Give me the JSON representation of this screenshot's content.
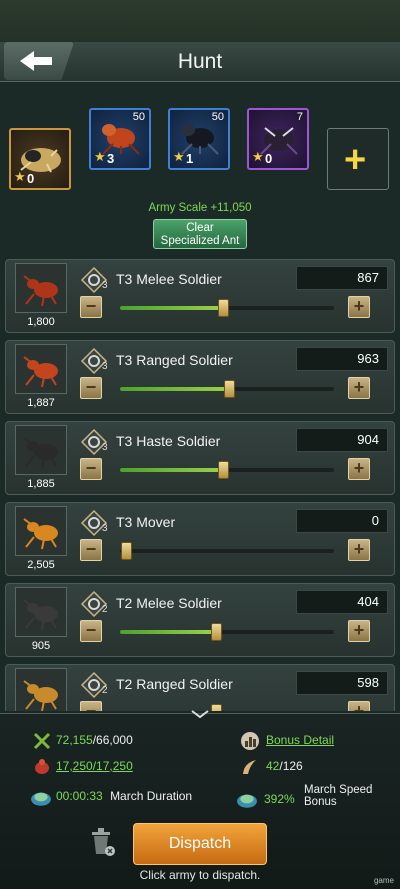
{
  "header": {
    "title": "Hunt"
  },
  "slots": [
    {
      "id": "gold",
      "star_level": "0",
      "count": ""
    },
    {
      "id": "red",
      "star_level": "3",
      "count": "50"
    },
    {
      "id": "black",
      "star_level": "1",
      "count": "50"
    },
    {
      "id": "purple",
      "star_level": "0",
      "count": "7"
    }
  ],
  "army_scale": "Army Scale +11,050",
  "clear_button": {
    "line1": "Clear",
    "line2": "Specialized Ant"
  },
  "troops": [
    {
      "name": "T3 Melee Soldier",
      "tier": "3",
      "available": "1,800",
      "value": "867",
      "fraction": 0.48
    },
    {
      "name": "T3 Ranged Soldier",
      "tier": "3",
      "available": "1,887",
      "value": "963",
      "fraction": 0.51
    },
    {
      "name": "T3 Haste Soldier",
      "tier": "3",
      "available": "1,885",
      "value": "904",
      "fraction": 0.48
    },
    {
      "name": "T3 Mover",
      "tier": "3",
      "available": "2,505",
      "value": "0",
      "fraction": 0.0
    },
    {
      "name": "T2 Melee Soldier",
      "tier": "2",
      "available": "905",
      "value": "404",
      "fraction": 0.45
    },
    {
      "name": "T2 Ranged Soldier",
      "tier": "2",
      "available": "",
      "value": "598",
      "fraction": 0.45
    }
  ],
  "stats": {
    "power_current": "72,155",
    "power_max": "/66,000",
    "bonus_detail": "Bonus Detail",
    "load": "17,250/17,250",
    "horn_current": "42",
    "horn_max": "/126",
    "march_time": "00:00:33",
    "march_duration_label": "March Duration",
    "speed_value": "392%",
    "speed_label_1": "March Speed",
    "speed_label_2": "Bonus"
  },
  "dispatch": {
    "label": "Dispatch",
    "hint": "Click army to dispatch."
  },
  "watermark": "game",
  "colors": {
    "accent_green": "#7ed957",
    "dispatch_orange": "#e08a22",
    "slider_green": "#6fb83a"
  }
}
